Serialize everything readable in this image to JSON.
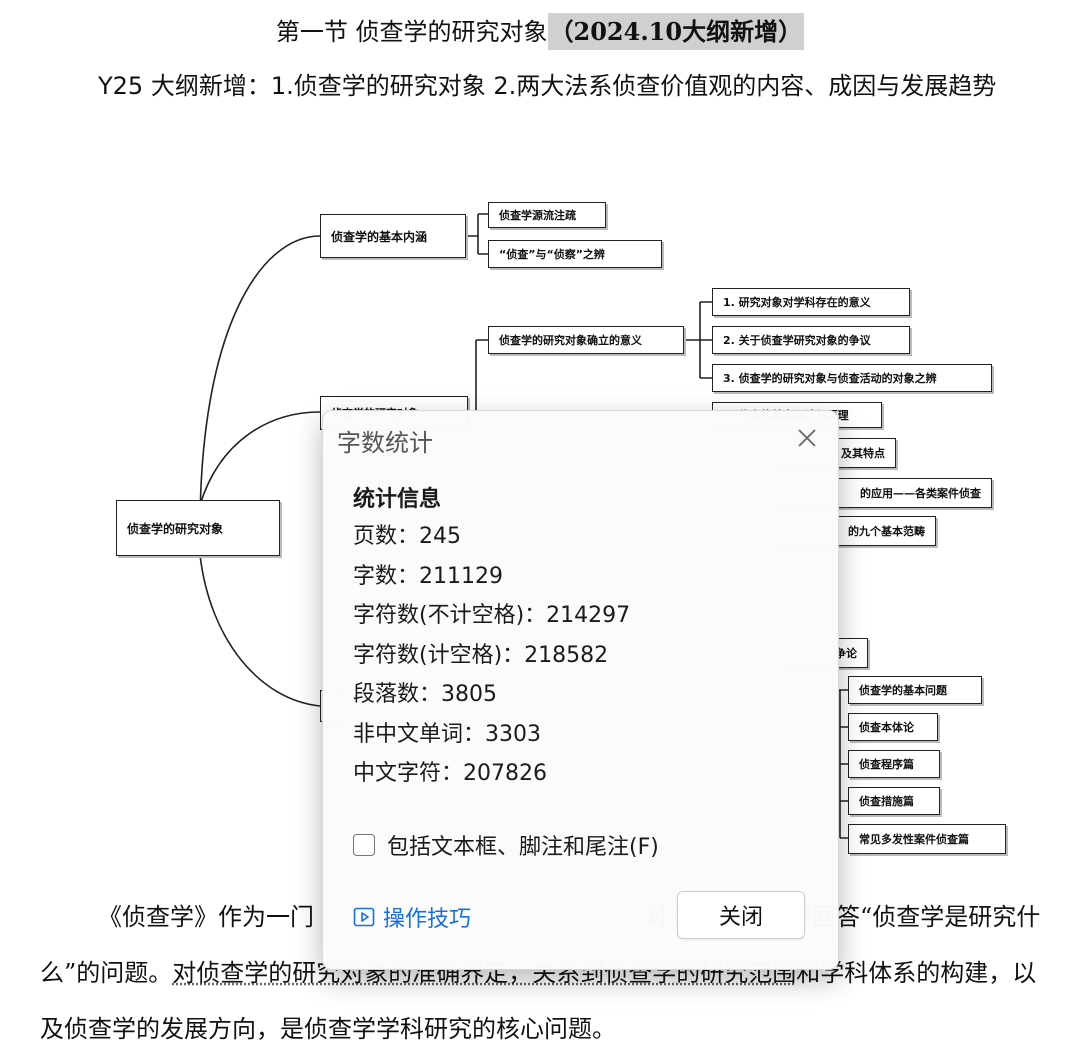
{
  "document": {
    "section_title": "第一节 侦查学的研究对象",
    "section_title_highlight": "（2024.10大纲新增）",
    "intro_prefix": "Y25",
    "intro_text": " 大纲新增：",
    "intro_item1": "1.",
    "intro_item1_text": "侦查学的研究对象  ",
    "intro_item2": "2.",
    "intro_item2_text": "两大法系侦查价值观的内容、成因与发展趋势",
    "body_part1": "《侦查学》作为一门",
    "body_part2": "对象，也就是要回答“侦查学是研究什么”的问题。",
    "body_underlined": "对侦查学的研究对象的准确界定，关系到侦查学的研究范围",
    "body_part3": "和学科体系的构建，以及侦查学的发展方向，是侦查学学科研究的核心问题。"
  },
  "mindmap": {
    "root": "侦查学的研究对象",
    "basic_meaning": "侦查学的基本内涵",
    "basic_meaning_children": [
      "侦查学源流注疏",
      "“侦查”与“侦察”之辨"
    ],
    "significance": "侦查学的研究对象确立的意义",
    "significance_children": [
      "1. 研究对象对学科存在的意义",
      "2. 关于侦查学研究对象的争议",
      "3. 侦查学的研究对象与侦查活动的对象之辨"
    ],
    "partial_branch": "侦查学的研究对象",
    "partial_items": [
      "4. 侦查的基本理论与原理",
      "及其特点",
      "的应用——各类案件侦查",
      "的九个基本范畴",
      "争论"
    ],
    "system_children": [
      "侦查学的基本问题",
      "侦查本体论",
      "侦查程序篇",
      "侦查措施篇",
      "常见多发性案件侦查篇"
    ]
  },
  "dialog": {
    "title": "字数统计",
    "section": "统计信息",
    "stats": [
      "页数：245",
      "字数：211129",
      "字符数(不计空格)：214297",
      "字符数(计空格)：218582",
      "段落数：3805",
      "非中文单词：3303",
      "中文字符：207826"
    ],
    "checkbox_label": "包括文本框、脚注和尾注(F)",
    "tips_label": "操作技巧",
    "close_label": "关闭",
    "link_color": "#1a6fd8"
  }
}
